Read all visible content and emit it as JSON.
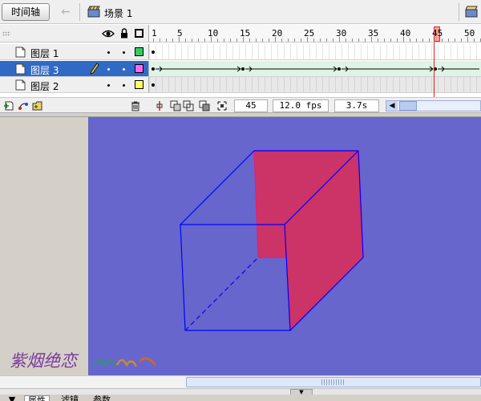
{
  "toolbar": {
    "timeline_button": "时间轴",
    "scene_label": "场景 1"
  },
  "timeline": {
    "ruler_marks": [
      "1",
      "5",
      "10",
      "15",
      "20",
      "25",
      "30",
      "35",
      "40",
      "45",
      "50"
    ],
    "playhead_frame": "45",
    "layers": [
      {
        "name": "图层 1",
        "swatch_color": "#33cc66",
        "selected": false
      },
      {
        "name": "图层 3",
        "swatch_color": "#ff66ff",
        "selected": true
      },
      {
        "name": "图层 2",
        "swatch_color": "#ffff66",
        "selected": false
      }
    ],
    "footer": {
      "current_frame": "45",
      "frame_rate": "12.0 fps",
      "elapsed_time": "3.7s"
    }
  },
  "stage": {
    "background_color": "#6666cc",
    "watermark": "紫烟绝恋"
  },
  "panel_tabs": {
    "properties": "属性",
    "filters": "滤镜",
    "parameters": "参数"
  },
  "colors": {
    "selection_blue": "#316ac5",
    "cube_stroke": "#0000ff",
    "face_fill": "#cc3366",
    "playhead_red": "#dd2222",
    "tween_green": "#dff4e6"
  }
}
